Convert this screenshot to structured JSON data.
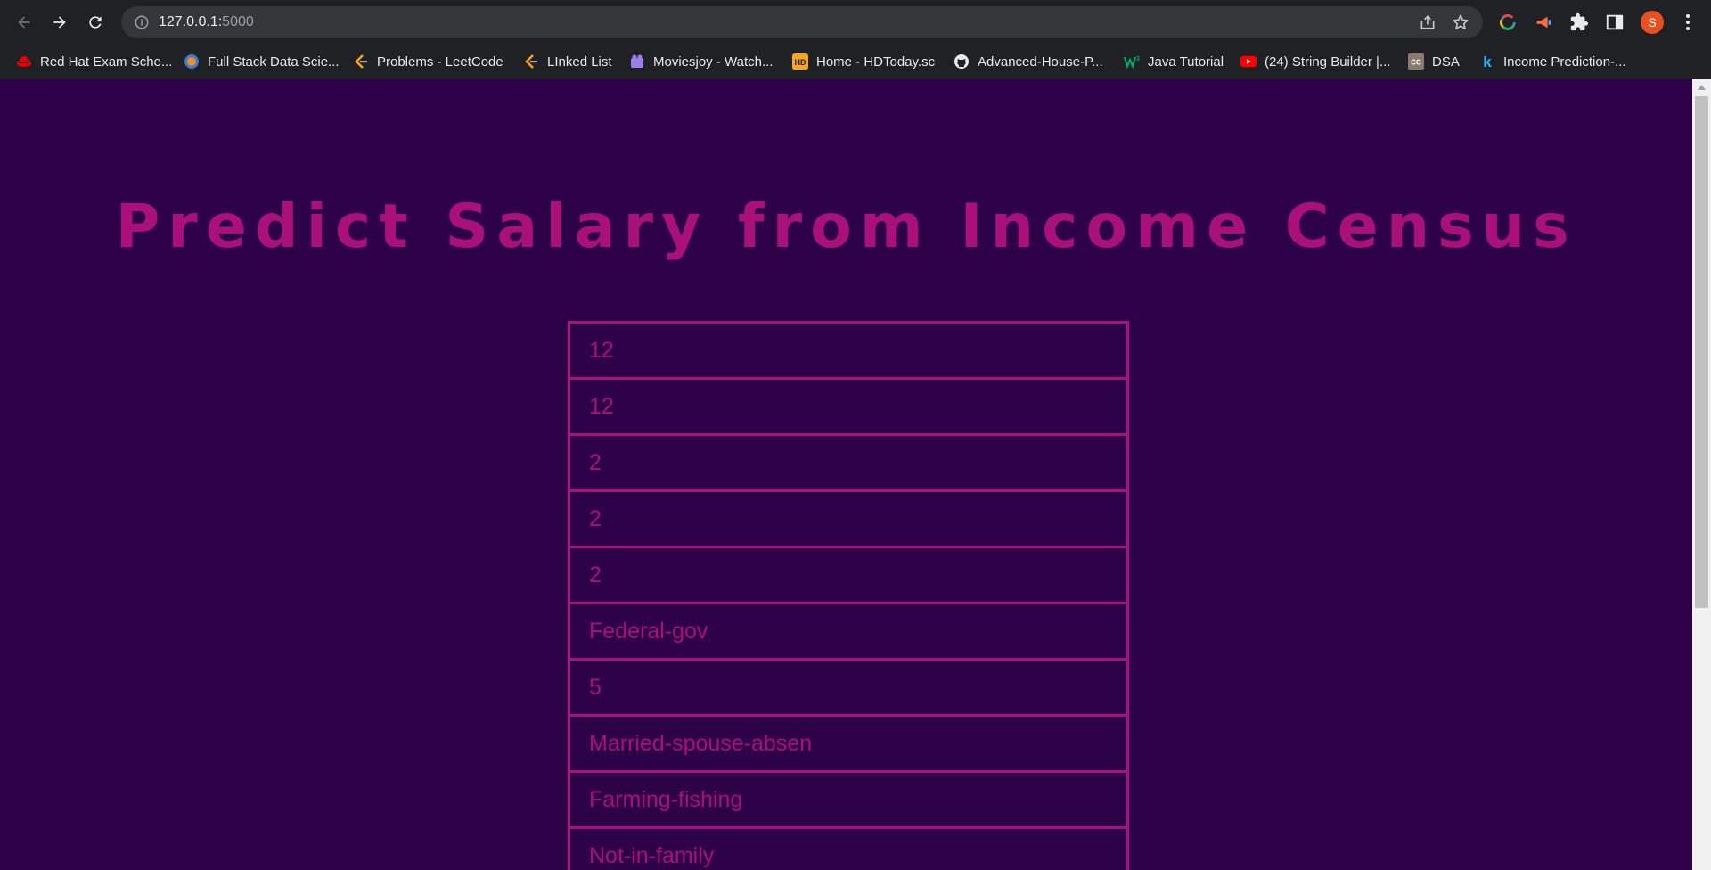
{
  "browser": {
    "url_host": "127.0.0.1:",
    "url_port": "5000",
    "profile_initial": "S",
    "icons": {
      "back": "arrow-left-icon",
      "forward": "arrow-right-icon",
      "reload": "reload-icon",
      "site_info": "info-icon",
      "share": "share-icon",
      "bookmark": "star-icon",
      "extensions": "puzzle-icon",
      "side_panel": "side-panel-icon",
      "menu": "kebab-menu-icon"
    }
  },
  "bookmarks": [
    {
      "label": "Red Hat Exam Sche...",
      "icon": "redhat-icon"
    },
    {
      "label": "Full Stack Data Scie...",
      "icon": "globe-icon"
    },
    {
      "label": "Problems - LeetCode",
      "icon": "leetcode-icon"
    },
    {
      "label": "LInked List",
      "icon": "leetcode-icon"
    },
    {
      "label": "Moviesjoy - Watch...",
      "icon": "moviesjoy-icon"
    },
    {
      "label": "Home - HDToday.sc",
      "icon": "hd-icon"
    },
    {
      "label": "Advanced-House-P...",
      "icon": "github-icon"
    },
    {
      "label": "Java Tutorial",
      "icon": "w3-icon"
    },
    {
      "label": "(24) String Builder |...",
      "icon": "youtube-icon"
    },
    {
      "label": "DSA",
      "icon": "cc-icon"
    },
    {
      "label": "Income Prediction-...",
      "icon": "kaggle-icon"
    }
  ],
  "page": {
    "title": "Predict Salary from Income Census",
    "colors": {
      "background": "#2e0249",
      "accent": "#a91079"
    }
  },
  "form": {
    "fields": [
      {
        "value": "12"
      },
      {
        "value": "12"
      },
      {
        "value": "2"
      },
      {
        "value": "2"
      },
      {
        "value": "2"
      },
      {
        "value": " Federal-gov"
      },
      {
        "value": "5"
      },
      {
        "value": " Married-spouse-absen"
      },
      {
        "value": " Farming-fishing"
      },
      {
        "value": " Not-in-family"
      }
    ]
  }
}
